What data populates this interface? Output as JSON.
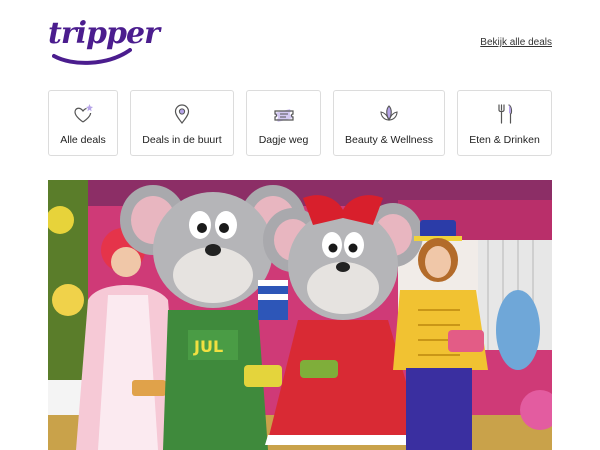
{
  "brand": {
    "logo_text": "tripper",
    "logo_color": "#4b1d8e"
  },
  "header": {
    "all_deals_link": "Bekijk alle deals"
  },
  "categories": [
    {
      "label": "Alle deals",
      "icon": "heart-star-icon"
    },
    {
      "label": "Deals in de buurt",
      "icon": "map-pin-icon"
    },
    {
      "label": "Dagje weg",
      "icon": "ticket-icon"
    },
    {
      "label": "Beauty & Wellness",
      "icon": "lotus-icon"
    },
    {
      "label": "Eten & Drinken",
      "icon": "fork-knife-icon"
    }
  ],
  "hero": {
    "description": "Promotional photo of costumed mouse mascots with performers",
    "apron_text": "JUL"
  },
  "colors": {
    "accent": "#4b1d8e",
    "accent_light": "#b6a4e8"
  }
}
